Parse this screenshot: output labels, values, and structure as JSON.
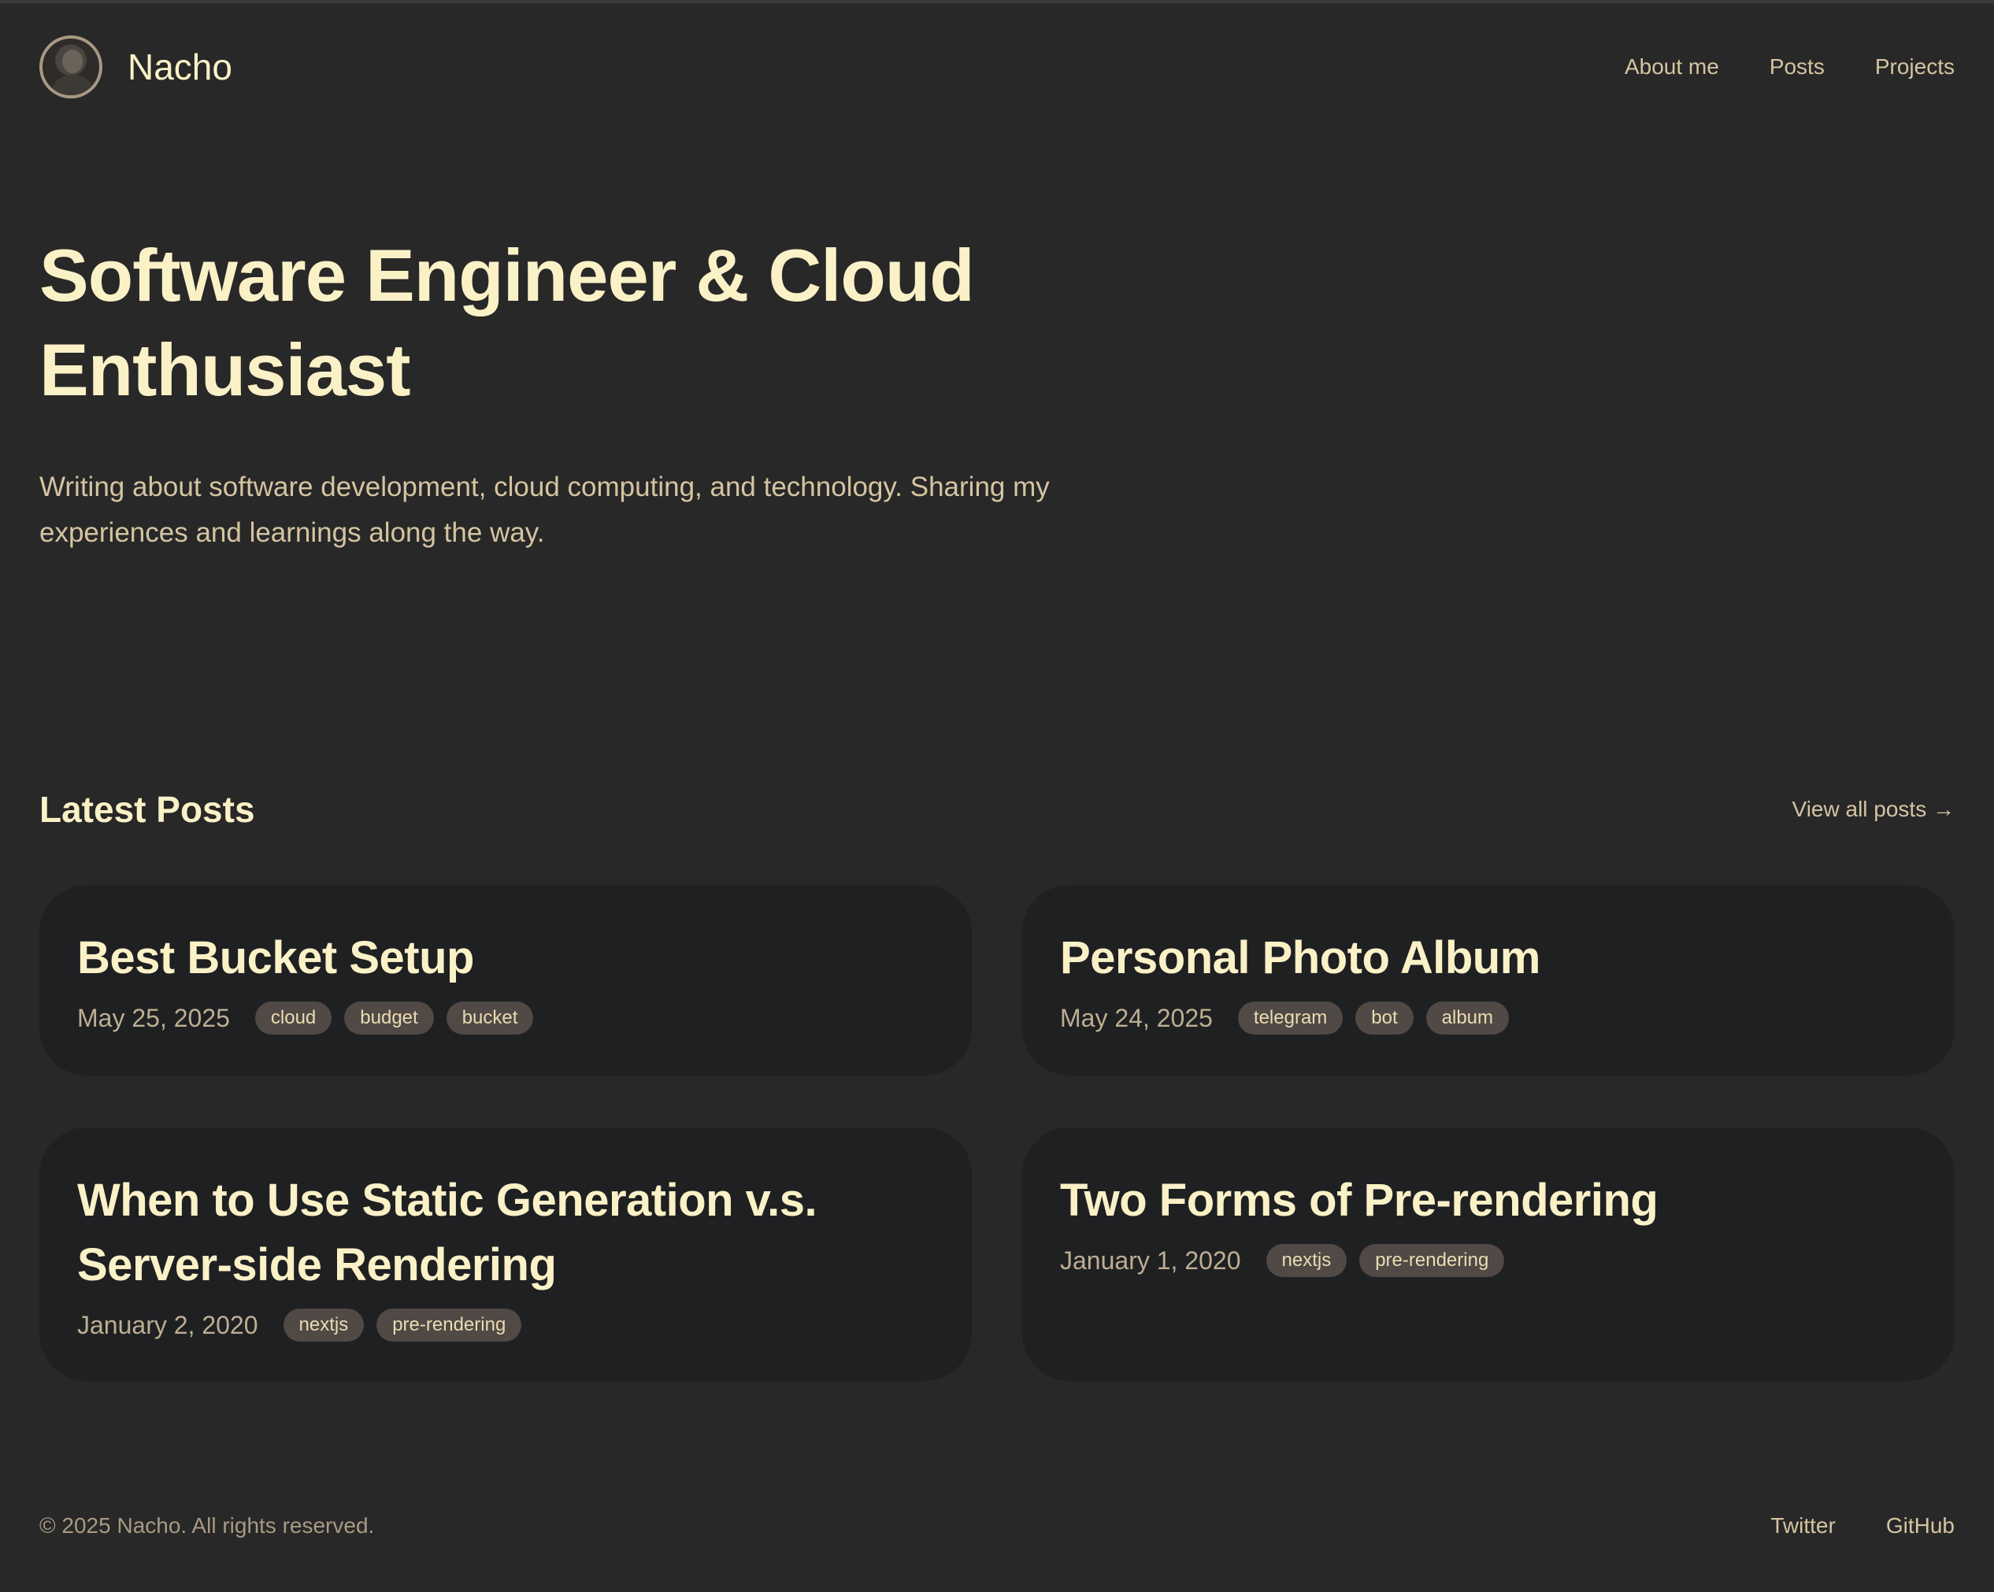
{
  "site": {
    "name": "Nacho"
  },
  "nav": {
    "items": [
      {
        "label": "About me"
      },
      {
        "label": "Posts"
      },
      {
        "label": "Projects"
      }
    ]
  },
  "hero": {
    "title": "Software Engineer & Cloud Enthusiast",
    "subtitle": "Writing about software development, cloud computing, and technology. Sharing my experiences and learnings along the way."
  },
  "latest": {
    "title": "Latest Posts",
    "view_all": "View all posts →"
  },
  "posts": [
    {
      "title": "Best Bucket Setup",
      "date": "May 25, 2025",
      "tags": [
        "cloud",
        "budget",
        "bucket"
      ]
    },
    {
      "title": "Personal Photo Album",
      "date": "May 24, 2025",
      "tags": [
        "telegram",
        "bot",
        "album"
      ]
    },
    {
      "title": "When to Use Static Generation v.s. Server-side Rendering",
      "date": "January 2, 2020",
      "tags": [
        "nextjs",
        "pre-rendering"
      ]
    },
    {
      "title": "Two Forms of Pre-rendering",
      "date": "January 1, 2020",
      "tags": [
        "nextjs",
        "pre-rendering"
      ]
    }
  ],
  "footer": {
    "copyright": "© 2025 Nacho. All rights reserved.",
    "links": [
      {
        "label": "Twitter"
      },
      {
        "label": "GitHub"
      }
    ]
  },
  "colors": {
    "background": "#282828",
    "card": "#1f2022",
    "heading": "#fbf1c7",
    "text": "#d5c4a1",
    "tag_bg": "#504945"
  }
}
